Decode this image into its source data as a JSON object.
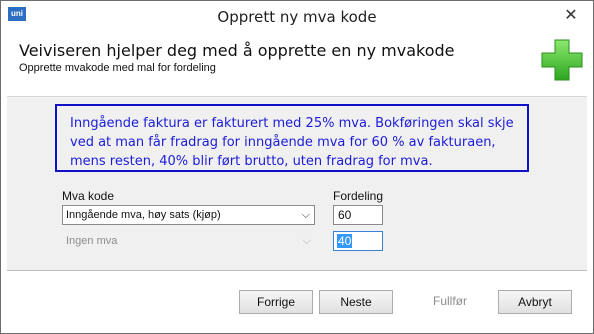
{
  "window": {
    "title": "Opprett ny mva kode",
    "app_icon_text": "uni",
    "close_glyph": "✕"
  },
  "header": {
    "title": "Veiviseren hjelper deg med å opprette en ny  mvakode",
    "subtitle": "Opprette mvakode med mal for fordeling",
    "icon": "green-plus-icon",
    "icon_color": "#3fbf2f"
  },
  "info": {
    "text": "Inngående faktura er fakturert med 25% mva. Bokføringen skal skje ved at man får fradrag for inngående mva for 60 % av fakturaen, mens resten, 40% blir ført brutto, uten fradrag for mva.",
    "border_color": "#1010c8",
    "text_color": "#1c1cd8"
  },
  "form": {
    "mva_label": "Mva kode",
    "fordeling_label": "Fordeling",
    "rows": [
      {
        "mva_value": "Inngående mva, høy sats (kjøp)",
        "fordeling": "60",
        "enabled": true
      },
      {
        "mva_value": "Ingen mva",
        "fordeling": "40",
        "enabled": false
      }
    ]
  },
  "buttons": {
    "prev": "Forrige",
    "next": "Neste",
    "finish": "Fullfør",
    "cancel": "Avbryt"
  }
}
